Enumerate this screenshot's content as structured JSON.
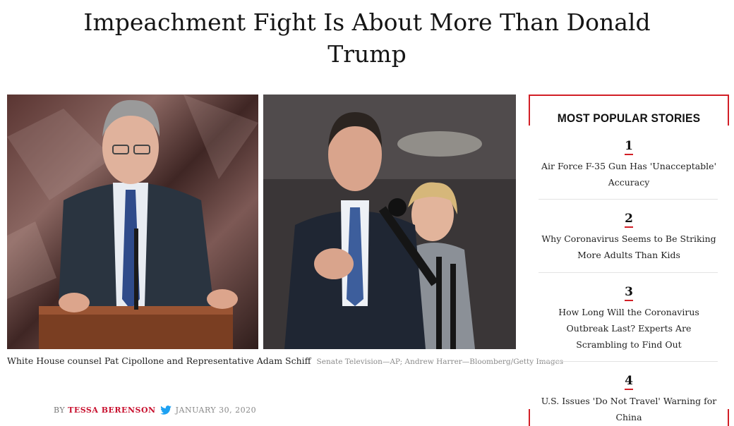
{
  "article": {
    "headline_lines": [
      "Impeachment Fight Is About More Than Donald",
      "Trump"
    ],
    "caption": "White House counsel Pat Cipollone and Representative Adam Schiff",
    "credit": "Senate Television—AP; Andrew Harrer—Bloomberg/Getty Images",
    "byline_prefix": "BY",
    "author": "TESSA BERENSON",
    "date": "JANUARY 30, 2020",
    "twitter_icon": "twitter-bird-icon",
    "accent_color": "#c8102e"
  },
  "popular": {
    "title": "MOST POPULAR STORIES",
    "frame_color": "#d21f26",
    "stories": [
      {
        "number": "1",
        "lines": [
          "Air Force F-35 Gun Has 'Unacceptable'",
          "Accuracy"
        ]
      },
      {
        "number": "2",
        "lines": [
          "Why Coronavirus Seems to Be Striking",
          "More Adults Than Kids"
        ]
      },
      {
        "number": "3",
        "lines": [
          "How Long Will the Coronavirus",
          "Outbreak Last? Experts Are",
          "Scrambling to Find Out"
        ]
      },
      {
        "number": "4",
        "lines": [
          "U.S. Issues 'Do Not Travel' Warning for",
          "China"
        ]
      }
    ]
  }
}
